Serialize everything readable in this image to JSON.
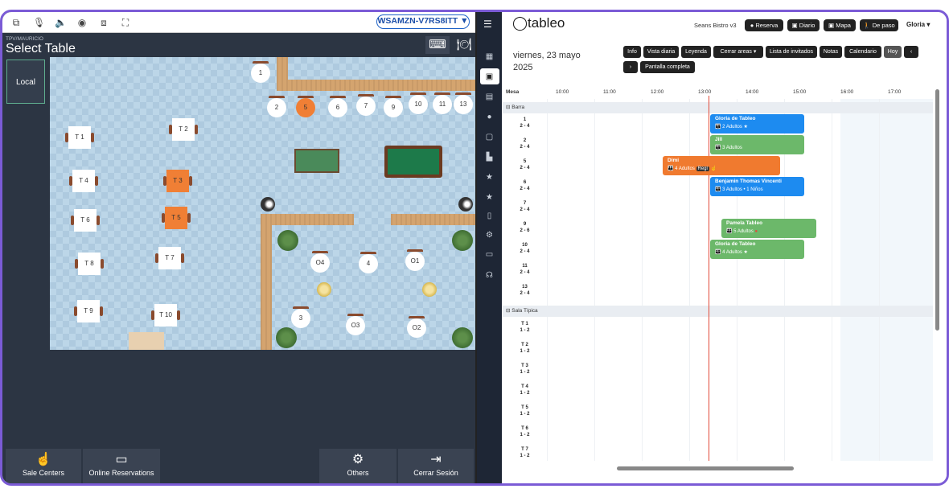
{
  "device_id": "WSAMZN-V7RS8ITT",
  "pos": {
    "subtitle": "TPV/MAURICIO",
    "title": "Select Table",
    "zone": "Local",
    "tables": [
      "1",
      "2",
      "5",
      "6",
      "7",
      "9",
      "10",
      "11",
      "13",
      "T 1",
      "T 2",
      "T 3",
      "T 4",
      "T 5",
      "T 6",
      "T 7",
      "T 8",
      "T 9",
      "T 10",
      "O4",
      "4",
      "O1",
      "3",
      "O3",
      "O2"
    ],
    "footer": {
      "sale_centers": "Sale Centers",
      "online_reservations": "Online Reservations",
      "others": "Others",
      "logout": "Cerrar Sesión"
    }
  },
  "tableo": {
    "logo": "tableo",
    "venue": "Seans Bistro v3",
    "header_buttons": [
      "Reserva",
      "Diario",
      "Mapa",
      "De paso"
    ],
    "user": "Gloria",
    "date_line1": "viernes, 23 mayo",
    "date_line2": "2025",
    "toolbar": [
      "Info",
      "Vista diaria",
      "Leyenda",
      "Cerrar areas",
      "Lista de invitados",
      "Notas",
      "Calendario",
      "Hoy",
      "Pantalla completa"
    ],
    "mesa_label": "Mesa",
    "hours": [
      "10:00",
      "11:00",
      "12:00",
      "13:00",
      "14:00",
      "15:00",
      "16:00",
      "17:00"
    ],
    "sections": [
      "Barra",
      "Sala Típica"
    ],
    "barra_rows": [
      {
        "name": "1",
        "cap": "2 - 4"
      },
      {
        "name": "2",
        "cap": "2 - 4"
      },
      {
        "name": "5",
        "cap": "2 - 4"
      },
      {
        "name": "6",
        "cap": "2 - 4"
      },
      {
        "name": "7",
        "cap": "2 - 4"
      },
      {
        "name": "9",
        "cap": "2 - 6"
      },
      {
        "name": "10",
        "cap": "2 - 4"
      },
      {
        "name": "11",
        "cap": "2 - 4"
      },
      {
        "name": "13",
        "cap": "2 - 4"
      }
    ],
    "sala_rows": [
      {
        "name": "T 1",
        "cap": "1 - 2"
      },
      {
        "name": "T 2",
        "cap": "1 - 2"
      },
      {
        "name": "T 3",
        "cap": "1 - 2"
      },
      {
        "name": "T 4",
        "cap": "1 - 2"
      },
      {
        "name": "T 5",
        "cap": "1 - 2"
      },
      {
        "name": "T 6",
        "cap": "1 - 2"
      },
      {
        "name": "T 7",
        "cap": "1 - 2"
      }
    ],
    "reservations": [
      {
        "name": "Gloria de Tableo",
        "detail": "2 Adultos",
        "color": "#1d8bf0"
      },
      {
        "name": "Jill",
        "detail": "3 Adultos",
        "color": "#6cb86a"
      },
      {
        "name": "Dimi",
        "detail": "4 Adultos",
        "tag": "Regl",
        "color": "#f07a2f"
      },
      {
        "name": "Benjamin Thomas Vincenti",
        "detail": "3 Adultos • 1 Niños",
        "color": "#1d8bf0"
      },
      {
        "name": "Pamela Tableo",
        "detail": "5 Adultos",
        "color": "#6cb86a"
      },
      {
        "name": "Gloria de Tableo",
        "detail": "4 Adultos",
        "color": "#6cb86a"
      }
    ]
  }
}
